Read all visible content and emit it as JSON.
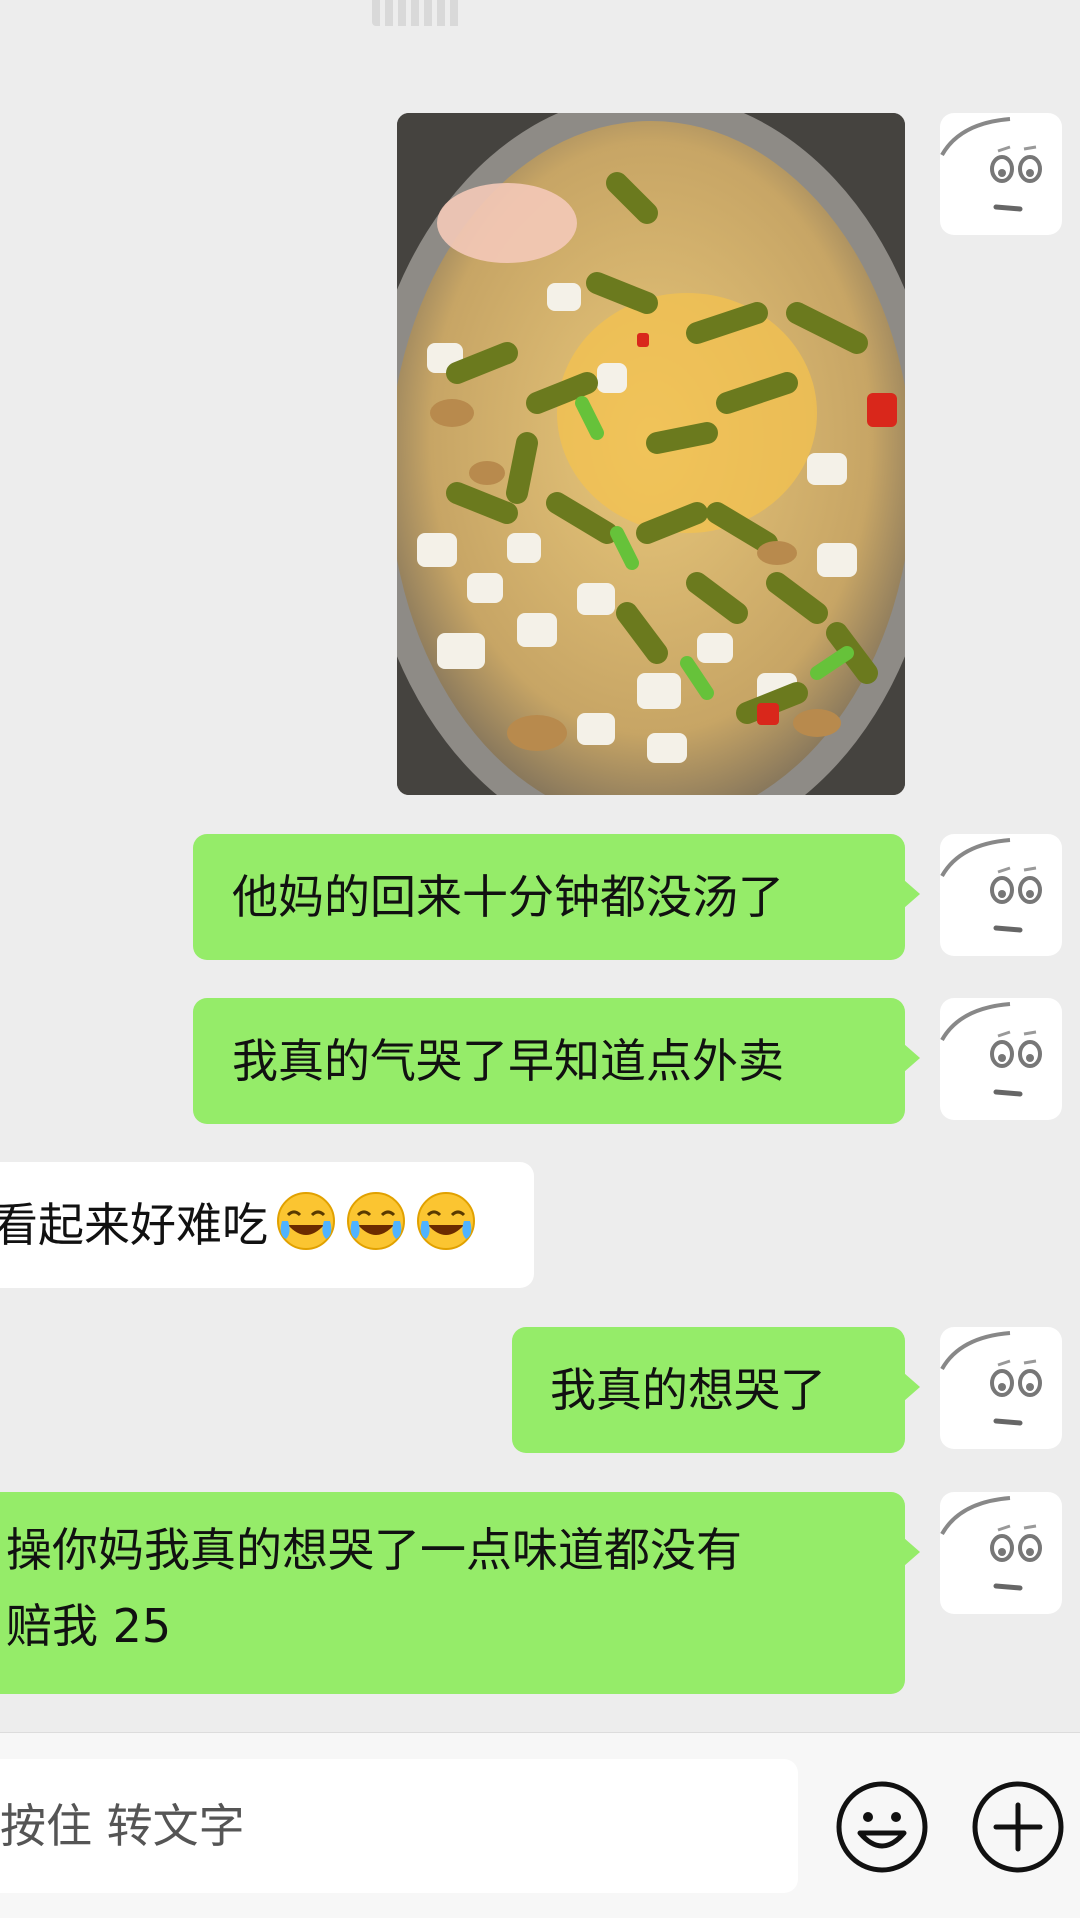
{
  "messages": [
    {
      "sender": "me",
      "type": "image",
      "image_desc": "food-photo"
    },
    {
      "sender": "me",
      "type": "text",
      "text": "他妈的回来十分钟都没汤了"
    },
    {
      "sender": "me",
      "type": "text",
      "text": "我真的气哭了早知道点外卖"
    },
    {
      "sender": "other",
      "type": "text",
      "text": "看起来好难吃",
      "emoji": [
        "laughing-crying-emoji",
        "laughing-crying-emoji",
        "laughing-crying-emoji"
      ]
    },
    {
      "sender": "me",
      "type": "text",
      "text": "我真的想哭了"
    },
    {
      "sender": "me",
      "type": "text",
      "lines": [
        "操你妈我真的想哭了一点味道都没有",
        "赔我 25"
      ]
    }
  ],
  "input": {
    "placeholder": "按住 转文字"
  },
  "toolbar": {
    "emoji_icon": "smiley-icon",
    "plus_icon": "plus-circle-icon"
  },
  "colors": {
    "background": "#ededed",
    "my_bubble": "#95ec69",
    "other_bubble": "#ffffff",
    "bottom_bar": "#f7f7f7"
  }
}
